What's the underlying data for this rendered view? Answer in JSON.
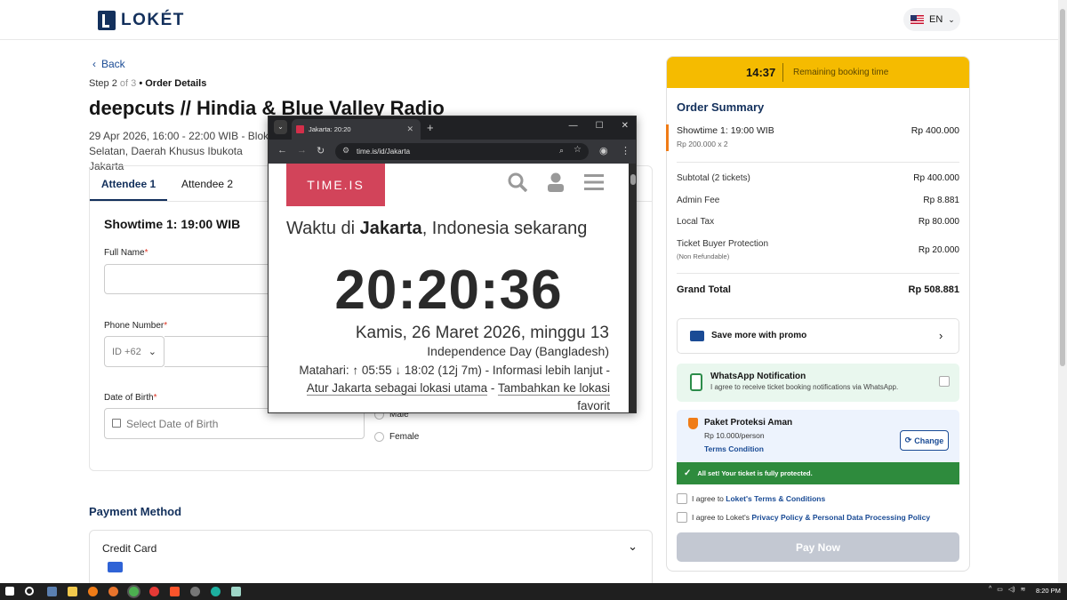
{
  "header": {
    "logo_text": "LOKÉT",
    "language": "EN"
  },
  "nav": {
    "back_label": "Back"
  },
  "step": {
    "prefix": "Step",
    "current": "2",
    "of_text": "of 3",
    "bullet": "•",
    "name": "Order Details"
  },
  "event": {
    "title": "deepcuts // Hindia & Blue Valley Radio",
    "date_line": "29 Apr 2026, 16:00 - 22:00 WIB - Blok",
    "location_line": "Selatan, Daerah Khusus Ibukota Jakarta"
  },
  "attendee_tabs": [
    "Attendee 1",
    "Attendee 2"
  ],
  "form": {
    "section_title": "Showtime 1: 19:00 WIB",
    "full_name_label": "Full Name",
    "phone_label": "Phone Number",
    "phone_code": "ID +62",
    "dob_label": "Date of Birth",
    "dob_placeholder": "Select Date of Birth",
    "gender_options": [
      "Male",
      "Female"
    ],
    "required_mark": "*"
  },
  "payment": {
    "heading": "Payment Method",
    "method": "Credit Card"
  },
  "booking_timer": {
    "time": "14:37",
    "label": "Remaining booking time"
  },
  "order_summary": {
    "title": "Order Summary",
    "item_name": "Showtime 1: 19:00 WIB",
    "item_price": "Rp 400.000",
    "item_detail": "Rp 200.000 x 2",
    "lines": [
      {
        "label": "Subtotal (2 tickets)",
        "value": "Rp 400.000"
      },
      {
        "label": "Admin Fee",
        "value": "Rp 8.881"
      },
      {
        "label": "Local Tax",
        "value": "Rp 80.000"
      },
      {
        "label": "Ticket Buyer Protection",
        "value": "Rp 20.000"
      }
    ],
    "protection_note": "(Non Refundable)",
    "grand_total_label": "Grand Total",
    "grand_total_value": "Rp 508.881"
  },
  "promo": {
    "label": "Save more with promo"
  },
  "whatsapp": {
    "title": "WhatsApp Notification",
    "subtitle": "I agree to receive ticket booking notifications via WhatsApp."
  },
  "protection": {
    "title": "Paket Proteksi Aman",
    "price": "Rp 10.000/person",
    "terms": "Terms Condition",
    "change_label": "Change",
    "status": "All set! Your ticket is fully protected."
  },
  "agreements": {
    "a1_prefix": "I agree to",
    "a1_link": "Loket's Terms & Conditions",
    "a2_prefix": "I agree to Loket's",
    "a2_link": "Privacy Policy & Personal Data Processing Policy"
  },
  "pay_button": "Pay Now",
  "browser": {
    "tab_title": "Jakarta: 20:20",
    "url": "time.is/id/Jakarta",
    "logo": "TIME.IS",
    "heading_prefix": "Waktu di",
    "heading_city": "Jakarta",
    "heading_suffix": ", Indonesia sekarang",
    "time": "20:20:36",
    "date": "Kamis, 26 Maret 2026, minggu 13",
    "holiday": "Independence Day (Bangladesh)",
    "sun_line": "Matahari: ↑ 05:55 ↓ 18:02 (12j 7m) - Informasi lebih lanjut -",
    "link1": "Atur Jakarta sebagai lokasi utama",
    "sep": " - ",
    "link2": "Tambahkan ke lokasi favorit"
  },
  "taskbar": {
    "clock": "8:20 PM"
  },
  "colors": {
    "brand_navy": "#13305c",
    "timer_yellow": "#f5bb00",
    "link_blue": "#1a4b95",
    "success_green": "#2e8b3d",
    "timeis_red": "#d2445a"
  }
}
